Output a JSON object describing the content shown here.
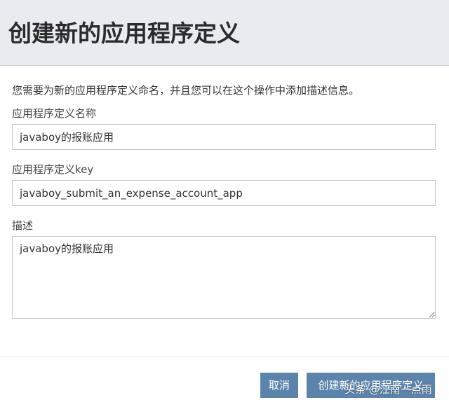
{
  "dialog": {
    "title": "创建新的应用程序定义",
    "intro": "您需要为新的应用程序定义命名，并且您可以在这个操作中添加描述信息。"
  },
  "form": {
    "name_label": "应用程序定义名称",
    "name_value": "javaboy的报账应用",
    "key_label": "应用程序定义key",
    "key_value": "javaboy_submit_an_expense_account_app",
    "description_label": "描述",
    "description_value": "javaboy的报账应用"
  },
  "footer": {
    "cancel_label": "取消",
    "create_label": "创建新的应用程序定义"
  },
  "watermark": "头条 @江南一点雨",
  "colors": {
    "header_bg": "#e8ebf0",
    "button_bg": "#5b84ad"
  }
}
